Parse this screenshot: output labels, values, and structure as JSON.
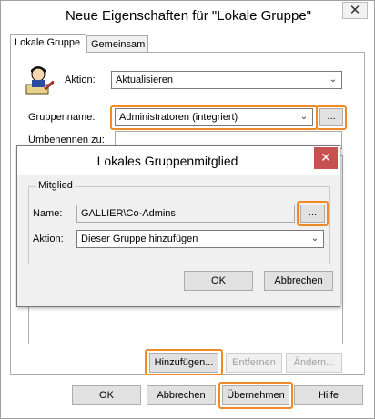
{
  "window": {
    "title": "Neue Eigenschaften für \"Lokale Gruppe\"",
    "close_glyph": "✕"
  },
  "tabs": [
    {
      "label": "Lokale Gruppe"
    },
    {
      "label": "Gemeinsam"
    }
  ],
  "form": {
    "aktion_label": "Aktion:",
    "aktion_value": "Aktualisieren",
    "gruppenname_label": "Gruppenname:",
    "gruppenname_value": "Administratoren (integriert)",
    "browse_label": "...",
    "umbenennen_label": "Umbenennen zu:"
  },
  "member_buttons": {
    "add": "Hinzufügen...",
    "remove": "Entfernen",
    "change": "Ändern..."
  },
  "footer": {
    "ok": "OK",
    "cancel": "Abbrechen",
    "apply": "Übernehmen",
    "help": "Hilfe"
  },
  "dialog": {
    "title": "Lokales Gruppenmitglied",
    "close_glyph": "✕",
    "group_title": "Mitglied",
    "name_label": "Name:",
    "name_value": "GALLIER\\Co-Admins",
    "browse_label": "...",
    "action_label": "Aktion:",
    "action_value": "Dieser Gruppe hinzufügen",
    "ok": "OK",
    "cancel": "Abbrechen"
  },
  "colors": {
    "highlight": "#f08a24",
    "dialog_close": "#c75050"
  },
  "icons": [
    "group-policy-user-icon",
    "chevron-down-icon",
    "close-icon"
  ]
}
